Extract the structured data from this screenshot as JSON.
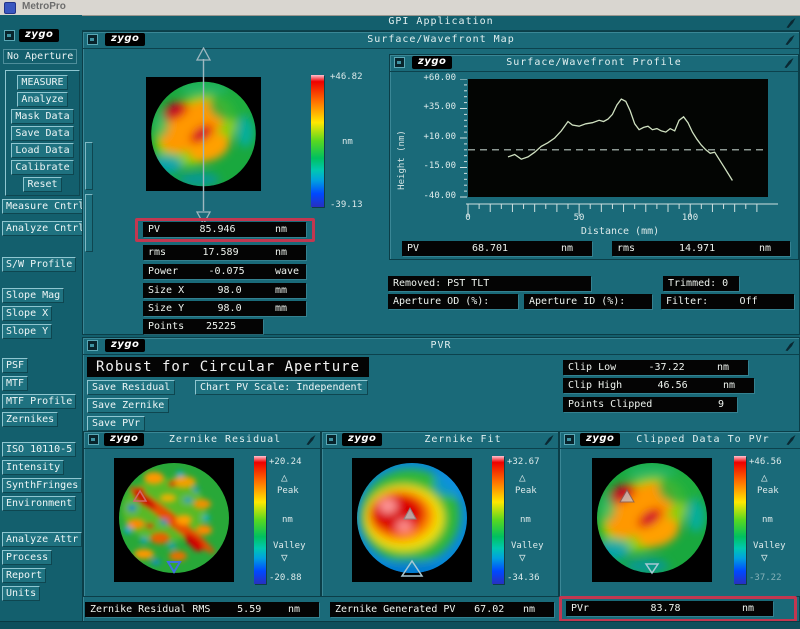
{
  "os": {
    "title": "MetroPro"
  },
  "app_title": "GPI Application",
  "brand": "zygo",
  "sidebar": {
    "aperture_label": "No Aperture",
    "main_buttons": [
      "MEASURE",
      "Analyze",
      "Mask Data",
      "Save Data",
      "Load Data",
      "Calibrate",
      "Reset"
    ],
    "cntrl_buttons": [
      "Measure Cntrl",
      "Analyze Cntrl"
    ],
    "profile_button": "S/W Profile",
    "slope_buttons": [
      "Slope Mag",
      "Slope X",
      "Slope Y"
    ],
    "optics_buttons": [
      "PSF",
      "MTF",
      "MTF Profile",
      "Zernikes"
    ],
    "misc_buttons": [
      "ISO 10110-5",
      "Intensity",
      "SynthFringes",
      "Environment"
    ],
    "bottom_buttons": [
      "Analyze Attr",
      "Process",
      "Report",
      "Units"
    ]
  },
  "map_window": {
    "title": "Surface/Wavefront Map",
    "colorbar": {
      "top": "+46.82",
      "unit": "nm",
      "bottom": "-39.13"
    },
    "stats": [
      {
        "label": "PV",
        "value": "85.946",
        "unit": "nm"
      },
      {
        "label": "rms",
        "value": "17.589",
        "unit": "nm"
      },
      {
        "label": "Power",
        "value": "-0.075",
        "unit": "wave"
      },
      {
        "label": "Size X",
        "value": "98.0",
        "unit": "mm"
      },
      {
        "label": "Size Y",
        "value": "98.0",
        "unit": "mm"
      },
      {
        "label": "Points",
        "value": "25225",
        "unit": ""
      }
    ],
    "info": {
      "removed_label": "Removed:",
      "removed_value": "PST TLT",
      "trimmed_label": "Trimmed:",
      "trimmed_value": "0",
      "aperture_od_label": "Aperture OD (%):",
      "aperture_id_label": "Aperture ID (%):",
      "filter_label": "Filter:",
      "filter_value": "Off"
    }
  },
  "profile_window": {
    "title": "Surface/Wavefront Profile",
    "stats": [
      {
        "label": "PV",
        "value": "68.701",
        "unit": "nm"
      },
      {
        "label": "rms",
        "value": "14.971",
        "unit": "nm"
      }
    ]
  },
  "chart_data": {
    "type": "line",
    "title": "Surface/Wavefront Profile",
    "xlabel": "Distance (mm)",
    "ylabel": "Height (nm)",
    "xlim": [
      0,
      135
    ],
    "ylim": [
      -40,
      60
    ],
    "yticks": [
      60,
      35,
      10,
      -15,
      -40
    ],
    "ytick_labels": [
      "+60.00",
      "+35.00",
      "+10.00",
      "-15.00",
      "-40.00"
    ],
    "xticks": [
      0,
      50,
      100
    ],
    "xtick_labels": [
      "0",
      "50",
      "100"
    ],
    "zero_line": 0,
    "grid": false,
    "x": [
      18,
      21,
      24,
      27,
      30,
      33,
      36,
      39,
      42,
      45,
      47,
      50,
      53,
      56,
      59,
      61,
      63,
      65,
      67,
      69,
      71,
      73,
      75,
      77,
      79,
      81,
      83,
      85,
      87,
      89,
      91,
      93,
      95,
      97,
      99,
      101,
      103,
      105,
      107,
      109,
      111,
      113,
      115,
      117,
      119
    ],
    "y": [
      -6,
      -4,
      -8,
      -6,
      -2,
      3,
      6,
      10,
      16,
      24,
      21,
      20,
      22,
      23,
      25,
      24,
      26,
      30,
      38,
      43,
      41,
      33,
      22,
      17,
      19,
      20,
      17,
      18,
      16,
      15,
      18,
      16,
      25,
      28,
      23,
      15,
      9,
      4,
      0,
      -3,
      -2,
      -8,
      -14,
      -20,
      -26
    ]
  },
  "pvr_window": {
    "title": "PVR",
    "header": "Robust for Circular Aperture",
    "save_residual": "Save Residual",
    "save_zernike": "Save Zernike",
    "save_pvr": "Save PVr",
    "scale_button": "Chart PV Scale: Independent",
    "clip_stats": [
      {
        "label": "Clip Low",
        "value": "-37.22",
        "unit": "nm"
      },
      {
        "label": "Clip High",
        "value": "46.56",
        "unit": "nm"
      },
      {
        "label": "Points Clipped",
        "value": "9",
        "unit": ""
      }
    ],
    "subwindows": [
      {
        "title": "Zernike Residual",
        "cb_top": "+20.24",
        "cb_bottom": "-20.88",
        "peak_label": "Peak",
        "valley_label": "Valley",
        "unit": "nm"
      },
      {
        "title": "Zernike Fit",
        "cb_top": "+32.67",
        "cb_bottom": "-34.36",
        "peak_label": "Peak",
        "valley_label": "Valley",
        "unit": "nm"
      },
      {
        "title": "Clipped Data To PVr",
        "cb_top": "+46.56",
        "cb_bottom": "-37.22",
        "peak_label": "Peak",
        "valley_label": "Valley",
        "unit": "nm"
      }
    ],
    "results": [
      {
        "label": "Zernike Residual RMS",
        "value": "5.59",
        "unit": "nm"
      },
      {
        "label": "Zernike Generated PV",
        "value": "67.02",
        "unit": "nm"
      },
      {
        "label": "PVr",
        "value": "83.78",
        "unit": "nm"
      }
    ]
  },
  "colors": {
    "accent_red": "#c23750",
    "teal_bg": "#135f6d",
    "window_bg": "#1a6a79"
  }
}
